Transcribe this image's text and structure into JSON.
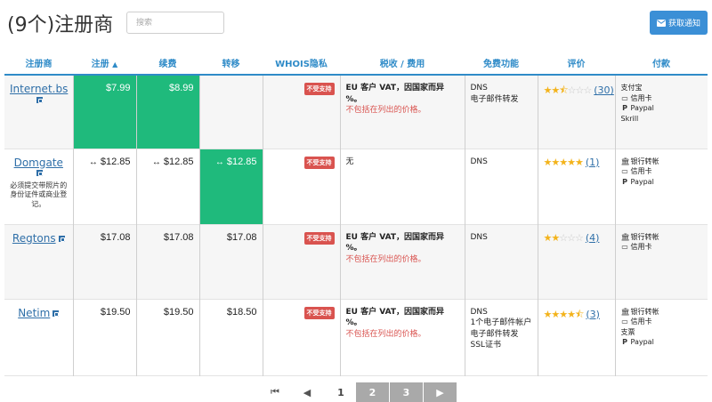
{
  "header": {
    "title": "(9个)注册商",
    "search_placeholder": "搜索",
    "notify_label": "获取通知"
  },
  "columns": {
    "registrar": "注册商",
    "register": "注册",
    "sort_indicator": "▲",
    "renew": "续费",
    "transfer": "转移",
    "whois": "WHOIS隐私",
    "tax": "税收 / 费用",
    "features": "免费功能",
    "rating": "评价",
    "payment": "付款"
  },
  "rows": [
    {
      "name": "Internet.bs",
      "note": "",
      "register": "$7.99",
      "renew": "$8.99",
      "transfer": "",
      "whois": "不受支持",
      "tax_line1": "EU 客户 VAT，因国家而异 %。",
      "tax_line2": "不包括在列出的价格。",
      "features": [
        "DNS",
        "电子邮件转发"
      ],
      "stars": "★★",
      "stars_empty": "☆☆☆",
      "rating_count": "(30)",
      "payments": [
        "支付宝",
        "信用卡",
        "Paypal",
        "Skrill"
      ]
    },
    {
      "name": "Domgate",
      "note": "必须提交带照片的身份证件或商业登记。",
      "register": "$12.85",
      "renew": "$12.85",
      "transfer": "$12.85",
      "whois": "不受支持",
      "tax_line1": "无",
      "tax_line2": "",
      "features": [
        "DNS"
      ],
      "stars": "★★★★★",
      "stars_empty": "",
      "rating_count": "(1)",
      "payments": [
        "银行转帐",
        "信用卡",
        "Paypal"
      ]
    },
    {
      "name": "Regtons",
      "note": "",
      "register": "$17.08",
      "renew": "$17.08",
      "transfer": "$17.08",
      "whois": "不受支持",
      "tax_line1": "EU 客户 VAT，因国家而异 %。",
      "tax_line2": "不包括在列出的价格。",
      "features": [
        "DNS"
      ],
      "stars": "★★",
      "stars_empty": "☆☆☆",
      "rating_count": "(4)",
      "payments": [
        "银行转帐",
        "信用卡"
      ]
    },
    {
      "name": "Netim",
      "note": "",
      "register": "$19.50",
      "renew": "$19.50",
      "transfer": "$18.50",
      "whois": "不受支持",
      "tax_line1": "EU 客户 VAT，因国家而异 %。",
      "tax_line2": "不包括在列出的价格。",
      "features": [
        "DNS",
        "1个电子邮件帐户",
        "电子邮件转发",
        "SSL证书"
      ],
      "stars": "★★★★",
      "stars_empty": "☆",
      "rating_count": "(3)",
      "payments": [
        "银行转帐",
        "信用卡",
        "支票",
        "Paypal"
      ]
    }
  ],
  "pagination": {
    "first": "⏮",
    "prev": "◀",
    "current": "1",
    "page2": "2",
    "page3": "3",
    "next": "▶"
  },
  "colors": {
    "accent": "#2f8bc8",
    "highlight": "#1fba7c",
    "badge": "#d9534f",
    "star": "#f3b31b"
  }
}
